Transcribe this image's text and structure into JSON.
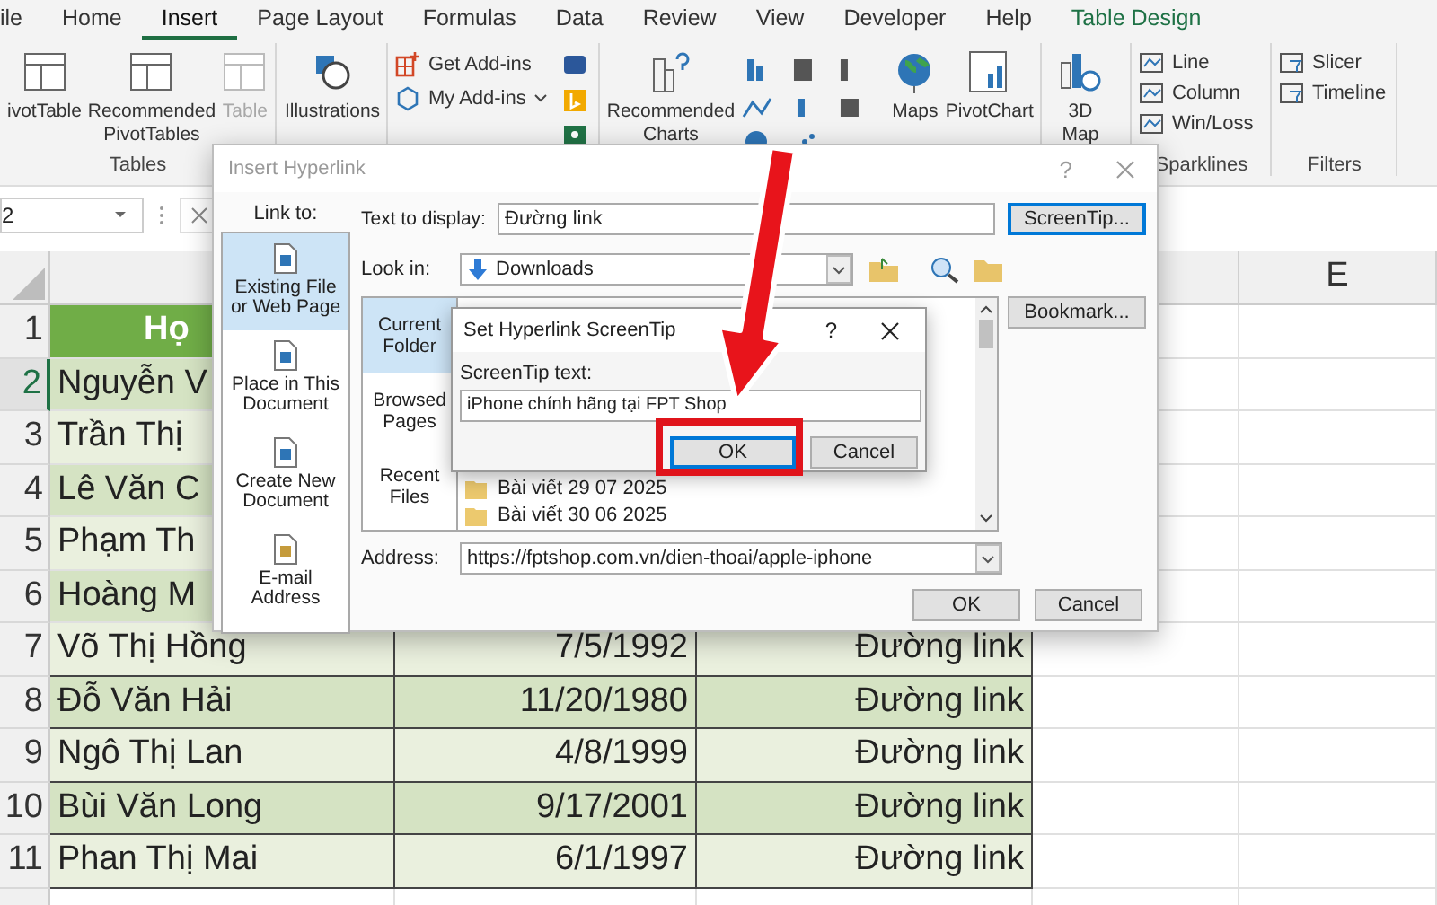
{
  "ribbon_tabs": [
    {
      "label": "ile",
      "selected": false,
      "kind": "normal"
    },
    {
      "label": "Home",
      "selected": false,
      "kind": "normal"
    },
    {
      "label": "Insert",
      "selected": true,
      "kind": "normal"
    },
    {
      "label": "Page Layout",
      "selected": false,
      "kind": "normal"
    },
    {
      "label": "Formulas",
      "selected": false,
      "kind": "normal"
    },
    {
      "label": "Data",
      "selected": false,
      "kind": "normal"
    },
    {
      "label": "Review",
      "selected": false,
      "kind": "normal"
    },
    {
      "label": "View",
      "selected": false,
      "kind": "normal"
    },
    {
      "label": "Developer",
      "selected": false,
      "kind": "normal"
    },
    {
      "label": "Help",
      "selected": false,
      "kind": "normal"
    },
    {
      "label": "Table Design",
      "selected": false,
      "kind": "contextual"
    }
  ],
  "ribbon": {
    "tables": {
      "label": "Tables",
      "items": [
        {
          "label": "ivotTable",
          "disabled": false
        },
        {
          "label": "Recommended PivotTables",
          "disabled": false
        },
        {
          "label": "Table",
          "disabled": true
        }
      ]
    },
    "illustrations": {
      "label": "Illustrations"
    },
    "add_ins": {
      "items": [
        "Get Add-ins",
        "My Add-ins"
      ]
    },
    "charts": {
      "recommended": "Recommended Charts",
      "maps": "Maps",
      "pivot_chart": "PivotChart"
    },
    "tours": {
      "label": "3D Map"
    },
    "sparklines": {
      "label": "Sparklines",
      "items": [
        "Line",
        "Column",
        "Win/Loss"
      ]
    },
    "filters": {
      "label": "Filters",
      "items": [
        "Slicer",
        "Timeline"
      ]
    }
  },
  "formula_bar": {
    "name_box": "2"
  },
  "sheet": {
    "column_header": "E",
    "rows": [
      {
        "number": "1",
        "selected": false,
        "kind": "header",
        "cells": [
          "Họ"
        ]
      },
      {
        "number": "2",
        "selected": true,
        "kind": "data",
        "cells": [
          "Nguyễn V"
        ]
      },
      {
        "number": "3",
        "selected": false,
        "kind": "data",
        "cells": [
          "Trần Thị"
        ]
      },
      {
        "number": "4",
        "selected": false,
        "kind": "data",
        "cells": [
          "Lê Văn C"
        ]
      },
      {
        "number": "5",
        "selected": false,
        "kind": "data",
        "cells": [
          "Phạm Th"
        ]
      },
      {
        "number": "6",
        "selected": false,
        "kind": "data",
        "cells": [
          "Hoàng M"
        ]
      },
      {
        "number": "7",
        "selected": false,
        "kind": "data",
        "cells": [
          "Võ Thị Hồng",
          "7/5/1992",
          "Đường link"
        ]
      },
      {
        "number": "8",
        "selected": false,
        "kind": "data",
        "cells": [
          "Đỗ Văn Hải",
          "11/20/1980",
          "Đường link"
        ]
      },
      {
        "number": "9",
        "selected": false,
        "kind": "data",
        "cells": [
          "Ngô Thị Lan",
          "4/8/1999",
          "Đường link"
        ]
      },
      {
        "number": "10",
        "selected": false,
        "kind": "data",
        "cells": [
          "Bùi Văn Long",
          "9/17/2001",
          "Đường link"
        ]
      },
      {
        "number": "11",
        "selected": false,
        "kind": "data",
        "cells": [
          "Phan Thị Mai",
          "6/1/1997",
          "Đường link"
        ]
      }
    ]
  },
  "insert_hyperlink_dialog": {
    "title": "Insert Hyperlink",
    "help": "?",
    "link_to_label": "Link to:",
    "link_to": [
      {
        "label": "Existing File or Web Page",
        "selected": true
      },
      {
        "label": "Place in This Document",
        "selected": false
      },
      {
        "label": "Create New Document",
        "selected": false
      },
      {
        "label": "E-mail Address",
        "selected": false
      }
    ],
    "text_to_display_label": "Text to display:",
    "text_to_display": "Đường link",
    "screentip_button": "ScreenTip...",
    "look_in_label": "Look in:",
    "look_in": "Downloads",
    "bookmark_button": "Bookmark...",
    "nav": [
      {
        "label": "Current Folder",
        "selected": true
      },
      {
        "label": "Browsed Pages",
        "selected": false
      },
      {
        "label": "Recent Files",
        "selected": false
      }
    ],
    "files": [
      "Bài viết 29 07 2025",
      "Bài viết 30 06 2025"
    ],
    "address_label": "Address:",
    "address": "https://fptshop.com.vn/dien-thoai/apple-iphone",
    "buttons": [
      "OK",
      "Cancel"
    ]
  },
  "screentip_dialog": {
    "title": "Set Hyperlink ScreenTip",
    "help": "?",
    "field_label": "ScreenTip text:",
    "value": "iPhone chính hãng tại FPT Shop",
    "buttons": [
      "OK",
      "Cancel"
    ]
  }
}
